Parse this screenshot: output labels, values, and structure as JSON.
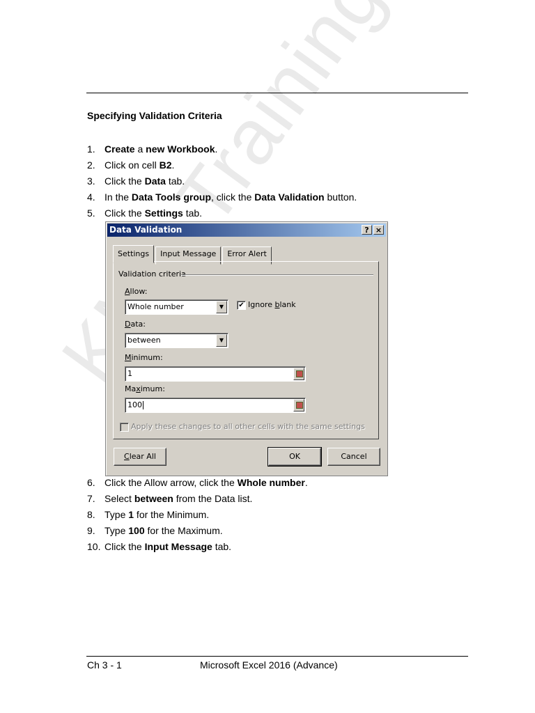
{
  "heading": "Specifying Validation Criteria",
  "steps_before": [
    {
      "num": "1.",
      "parts": [
        {
          "t": "Create",
          "b": true
        },
        {
          "t": " a ",
          "b": false
        },
        {
          "t": "new Workbook",
          "b": true
        },
        {
          "t": ".",
          "b": false
        }
      ]
    },
    {
      "num": "2.",
      "parts": [
        {
          "t": "Click on cell ",
          "b": false
        },
        {
          "t": "B2",
          "b": true
        },
        {
          "t": ".",
          "b": false
        }
      ]
    },
    {
      "num": "3.",
      "parts": [
        {
          "t": "Click the ",
          "b": false
        },
        {
          "t": "Data",
          "b": true
        },
        {
          "t": " tab.",
          "b": false
        }
      ]
    },
    {
      "num": "4.",
      "parts": [
        {
          "t": "In the ",
          "b": false
        },
        {
          "t": "Data Tools group",
          "b": true
        },
        {
          "t": ", click the ",
          "b": false
        },
        {
          "t": "Data Validation",
          "b": true
        },
        {
          "t": " button.",
          "b": false
        }
      ]
    },
    {
      "num": "5.",
      "parts": [
        {
          "t": "Click the ",
          "b": false
        },
        {
          "t": "Settings",
          "b": true
        },
        {
          "t": " tab.",
          "b": false
        }
      ]
    }
  ],
  "steps_after": [
    {
      "num": "6.",
      "parts": [
        {
          "t": "Click the Allow arrow, click the ",
          "b": false
        },
        {
          "t": "Whole number",
          "b": true
        },
        {
          "t": ".",
          "b": false
        }
      ]
    },
    {
      "num": "7.",
      "parts": [
        {
          "t": "Select ",
          "b": false
        },
        {
          "t": "between",
          "b": true
        },
        {
          "t": " from the Data list.",
          "b": false
        }
      ]
    },
    {
      "num": "8.",
      "parts": [
        {
          "t": "Type ",
          "b": false
        },
        {
          "t": "1",
          "b": true
        },
        {
          "t": " for the Minimum.",
          "b": false
        }
      ]
    },
    {
      "num": "9.",
      "parts": [
        {
          "t": "Type ",
          "b": false
        },
        {
          "t": "100",
          "b": true
        },
        {
          "t": " for the Maximum.",
          "b": false
        }
      ]
    },
    {
      "num": "10.",
      "parts": [
        {
          "t": "Click the ",
          "b": false
        },
        {
          "t": "Input Message",
          "b": true
        },
        {
          "t": " tab.",
          "b": false
        }
      ]
    }
  ],
  "dialog": {
    "title": "Data Validation",
    "help_glyph": "?",
    "close_glyph": "×",
    "tabs": [
      "Settings",
      "Input Message",
      "Error Alert"
    ],
    "group_label": "Validation criteria",
    "allow_label": "Allow:",
    "allow_value": "Whole number",
    "ignore_blank_label": "Ignore blank",
    "ignore_blank_checked": "✔",
    "data_label": "Data:",
    "data_value": "between",
    "minimum_label": "Minimum:",
    "minimum_value": "1",
    "maximum_label": "Maximum:",
    "maximum_value": "100",
    "apply_all_label": "Apply these changes to all other cells with the same settings",
    "clear_all_label": "Clear All",
    "ok_label": "OK",
    "cancel_label": "Cancel",
    "dropdown_glyph": "▼"
  },
  "watermark": "KMB Training Centre",
  "footer": {
    "left": "Ch 3 - 1",
    "center": "Microsoft Excel 2016 (Advance)"
  }
}
